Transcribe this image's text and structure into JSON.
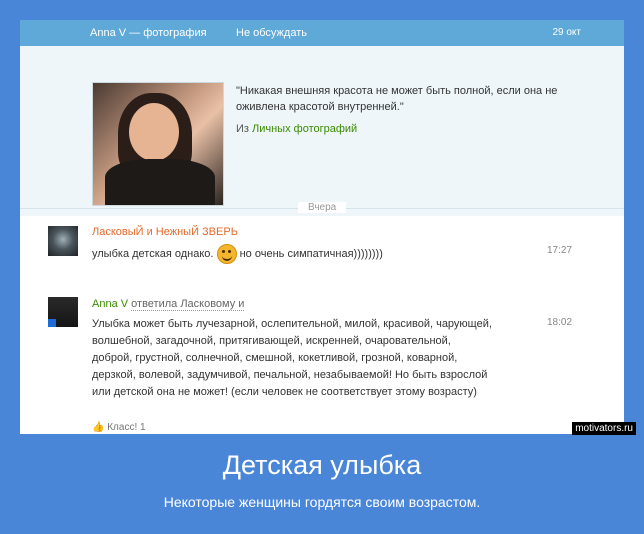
{
  "header": {
    "author": "Anna V — фотография",
    "action": "Не обсуждать",
    "date": "29 окт"
  },
  "post": {
    "quote": "\"Никакая внешняя красота не может быть полной, если она не оживлена красотой внутренней.\"",
    "from_prefix": "Из",
    "from_link": "Личных фотографий"
  },
  "divider": "Вчера",
  "comments": [
    {
      "author": "ЛасковыЙ и НежныЙ ЗВЕРЬ",
      "text_before": "улыбка детская однако.",
      "text_after": "но очень симпатичная))))))))",
      "time": "17:27"
    },
    {
      "author": "Anna V",
      "reply_to": "ответила Ласковому и",
      "text": "Улыбка может быть лучезарной, ослепительной, милой, красивой, чарующей, волшебной, загадочной, притягивающей, искренней, очаровательной, доброй, грустной, солнечной, смешной, кокетливой, грозной, коварной, дерзкой, волевой, задумчивой, печальной, незабываемой! Но быть взрослой или детской она не может! (если человек не соответствует этому возрасту)",
      "time": "18:02",
      "klass": "Класс! 1"
    }
  ],
  "watermark": "motivators.ru",
  "poster": {
    "title": "Детская улыбка",
    "subtitle": "Некоторые женщины гордятся своим возрастом."
  }
}
